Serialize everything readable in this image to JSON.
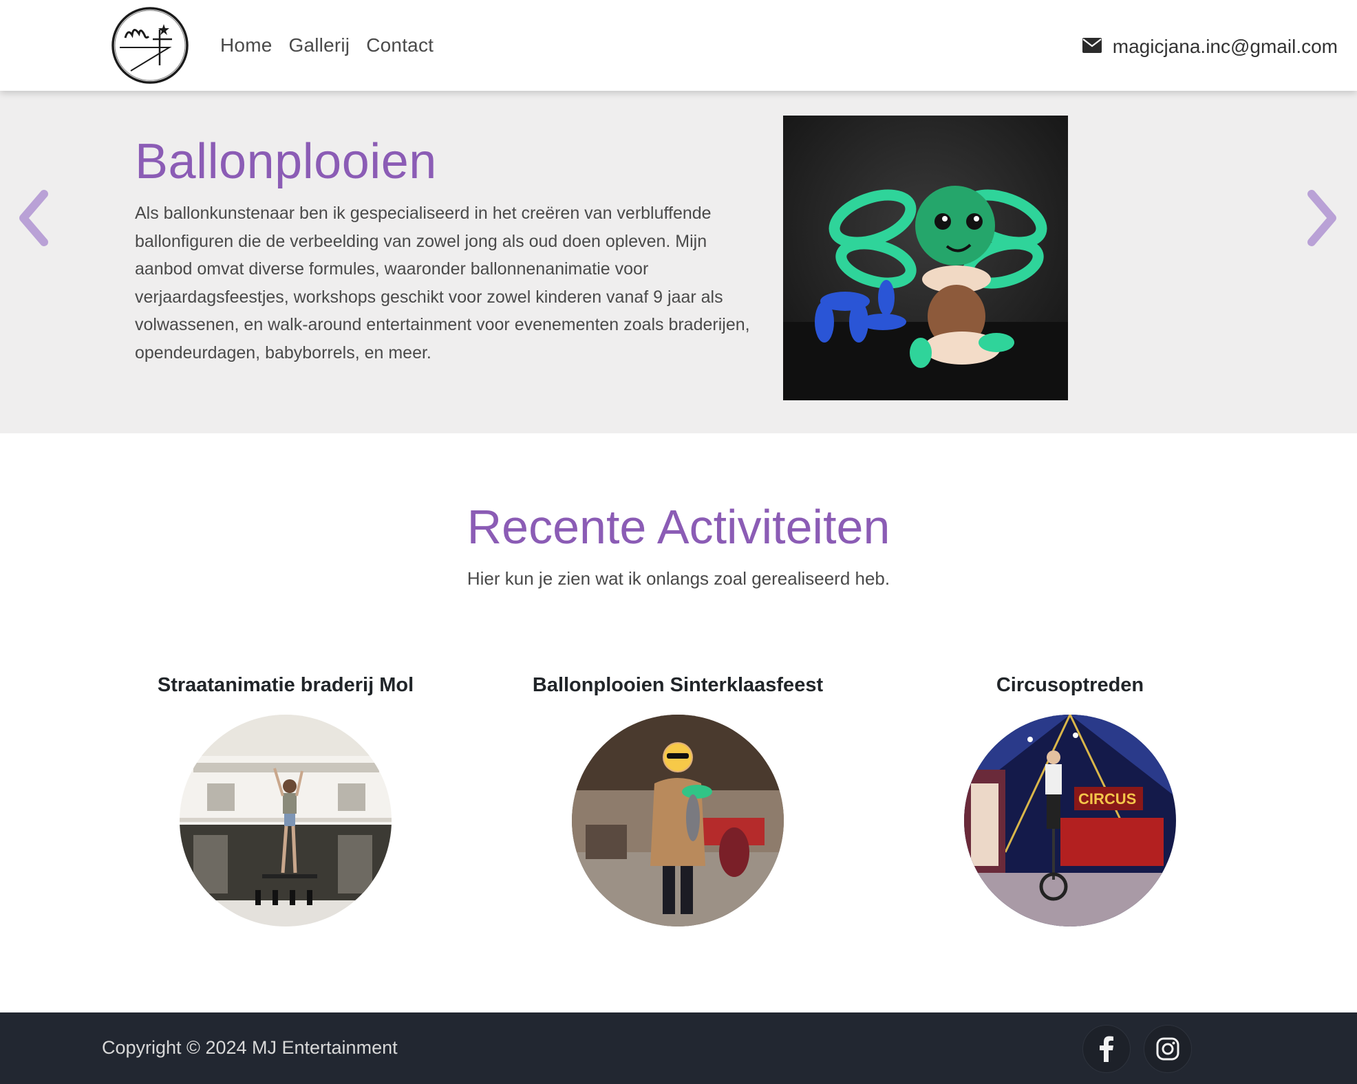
{
  "nav": {
    "links": [
      "Home",
      "Gallerij",
      "Contact"
    ],
    "email": "magicjana.inc@gmail.com"
  },
  "hero": {
    "title": "Ballonplooien",
    "text": "Als ballonkunstenaar ben ik gespecialiseerd in het creëren van verbluffende ballonfiguren die de verbeelding van zowel jong als oud doen opleven. Mijn aanbod omvat diverse formules, waaronder ballonnenanimatie voor verjaardagsfeestjes, workshops geschikt voor zowel kinderen vanaf 9 jaar als volwassenen, en walk-around entertainment voor evenementen zoals braderijen, opendeurdagen, babyborrels, en meer."
  },
  "recent": {
    "title": "Recente Activiteiten",
    "subtitle": "Hier kun je zien wat ik onlangs zoal gerealiseerd heb.",
    "items": [
      {
        "title": "Straatanimatie braderij Mol"
      },
      {
        "title": "Ballonplooien Sinterklaasfeest"
      },
      {
        "title": "Circusoptreden"
      }
    ]
  },
  "footer": {
    "copyright": "Copyright © 2024 MJ Entertainment"
  },
  "colors": {
    "accent": "#8b5cb5",
    "arrow": "#b9a1d6",
    "hero_bg": "#efeeee",
    "footer_bg": "#222731"
  },
  "icons": [
    "logo",
    "envelope-icon",
    "chevron-left-icon",
    "chevron-right-icon",
    "facebook-icon",
    "instagram-icon"
  ]
}
